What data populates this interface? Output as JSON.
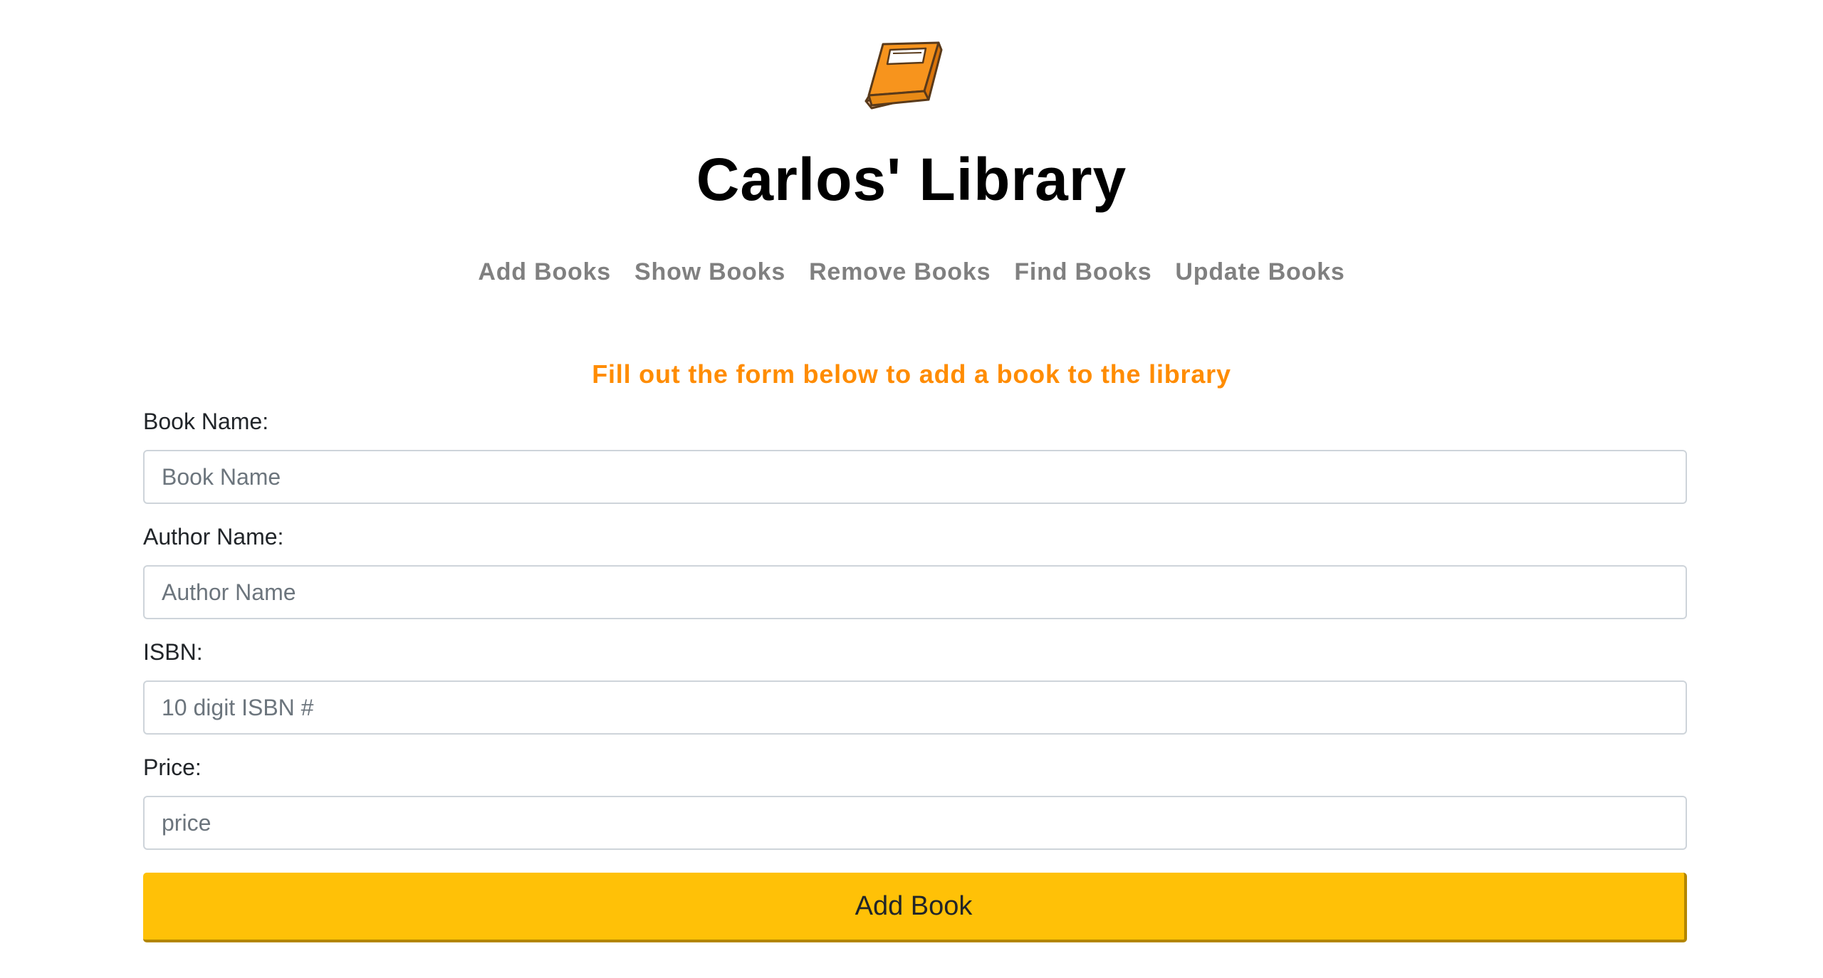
{
  "header": {
    "logo_icon": "book-icon",
    "title": "Carlos' Library"
  },
  "nav": {
    "items": [
      {
        "label": "Add Books"
      },
      {
        "label": "Show Books"
      },
      {
        "label": "Remove Books"
      },
      {
        "label": "Find Books"
      },
      {
        "label": "Update Books"
      }
    ]
  },
  "form": {
    "instructions": "Fill out the form below to add a book to the library",
    "book_name": {
      "label": "Book Name:",
      "placeholder": "Book Name",
      "value": ""
    },
    "author_name": {
      "label": "Author Name:",
      "placeholder": "Author Name",
      "value": ""
    },
    "isbn": {
      "label": "ISBN:",
      "placeholder": "10 digit ISBN #",
      "value": ""
    },
    "price": {
      "label": "Price:",
      "placeholder": "price",
      "value": ""
    },
    "submit_label": "Add Book"
  },
  "colors": {
    "accent_orange": "#ff8c00",
    "button_yellow": "#ffc107",
    "nav_gray": "#808080",
    "book_orange": "#f7941d"
  }
}
